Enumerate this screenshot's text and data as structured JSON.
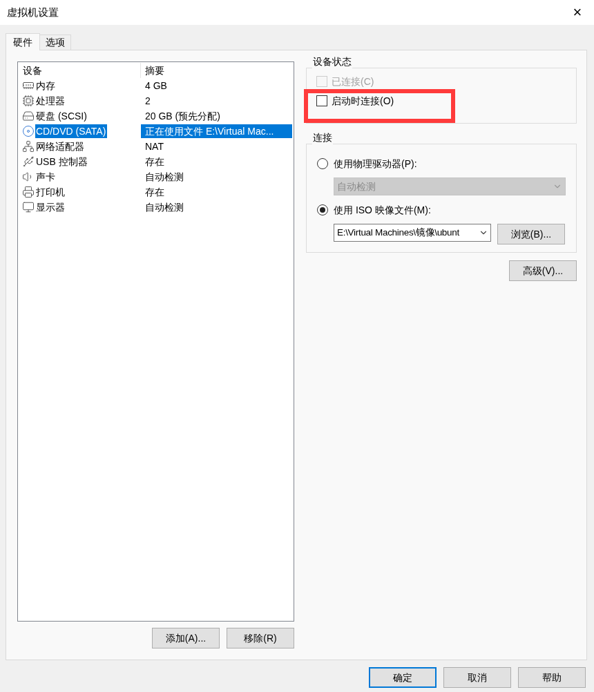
{
  "window": {
    "title": "虚拟机设置",
    "close": "×"
  },
  "tabs": [
    {
      "label": "硬件",
      "selected": true
    },
    {
      "label": "选项",
      "selected": false
    }
  ],
  "devices": {
    "columns": [
      "设备",
      "摘要"
    ],
    "rows": [
      {
        "kind": "memory",
        "device": "内存",
        "summary": "4 GB",
        "selected": false
      },
      {
        "kind": "cpu",
        "device": "处理器",
        "summary": "2",
        "selected": false
      },
      {
        "kind": "disk",
        "device": "硬盘 (SCSI)",
        "summary": "20 GB (预先分配)",
        "selected": false
      },
      {
        "kind": "cd",
        "device": "CD/DVD (SATA)",
        "summary": "正在使用文件 E:\\Virtual Mac...",
        "selected": true
      },
      {
        "kind": "network",
        "device": "网络适配器",
        "summary": "NAT",
        "selected": false
      },
      {
        "kind": "usb",
        "device": "USB 控制器",
        "summary": "存在",
        "selected": false
      },
      {
        "kind": "sound",
        "device": "声卡",
        "summary": "自动检测",
        "selected": false
      },
      {
        "kind": "printer",
        "device": "打印机",
        "summary": "存在",
        "selected": false
      },
      {
        "kind": "display",
        "device": "显示器",
        "summary": "自动检测",
        "selected": false
      }
    ],
    "buttons": [
      "添加(A)...",
      "移除(R)"
    ]
  },
  "device_status": {
    "title": "设备状态",
    "options": [
      {
        "label": "已连接(C)",
        "checked": false,
        "disabled": true
      },
      {
        "label": "启动时连接(O)",
        "checked": false,
        "disabled": false,
        "highlighted": true
      }
    ]
  },
  "connection": {
    "title": "连接",
    "physical": {
      "label": "使用物理驱动器(P):",
      "selected": false,
      "value": "自动检测",
      "disabled": true
    },
    "iso": {
      "label": "使用 ISO 映像文件(M):",
      "selected": true,
      "value": "E:\\Virtual Machines\\镜像\\ubunt",
      "browse": "浏览(B)..."
    }
  },
  "advanced": "高级(V)...",
  "footer_buttons": [
    {
      "label": "确定",
      "default": true
    },
    {
      "label": "取消",
      "default": false
    },
    {
      "label": "帮助",
      "default": false
    }
  ]
}
